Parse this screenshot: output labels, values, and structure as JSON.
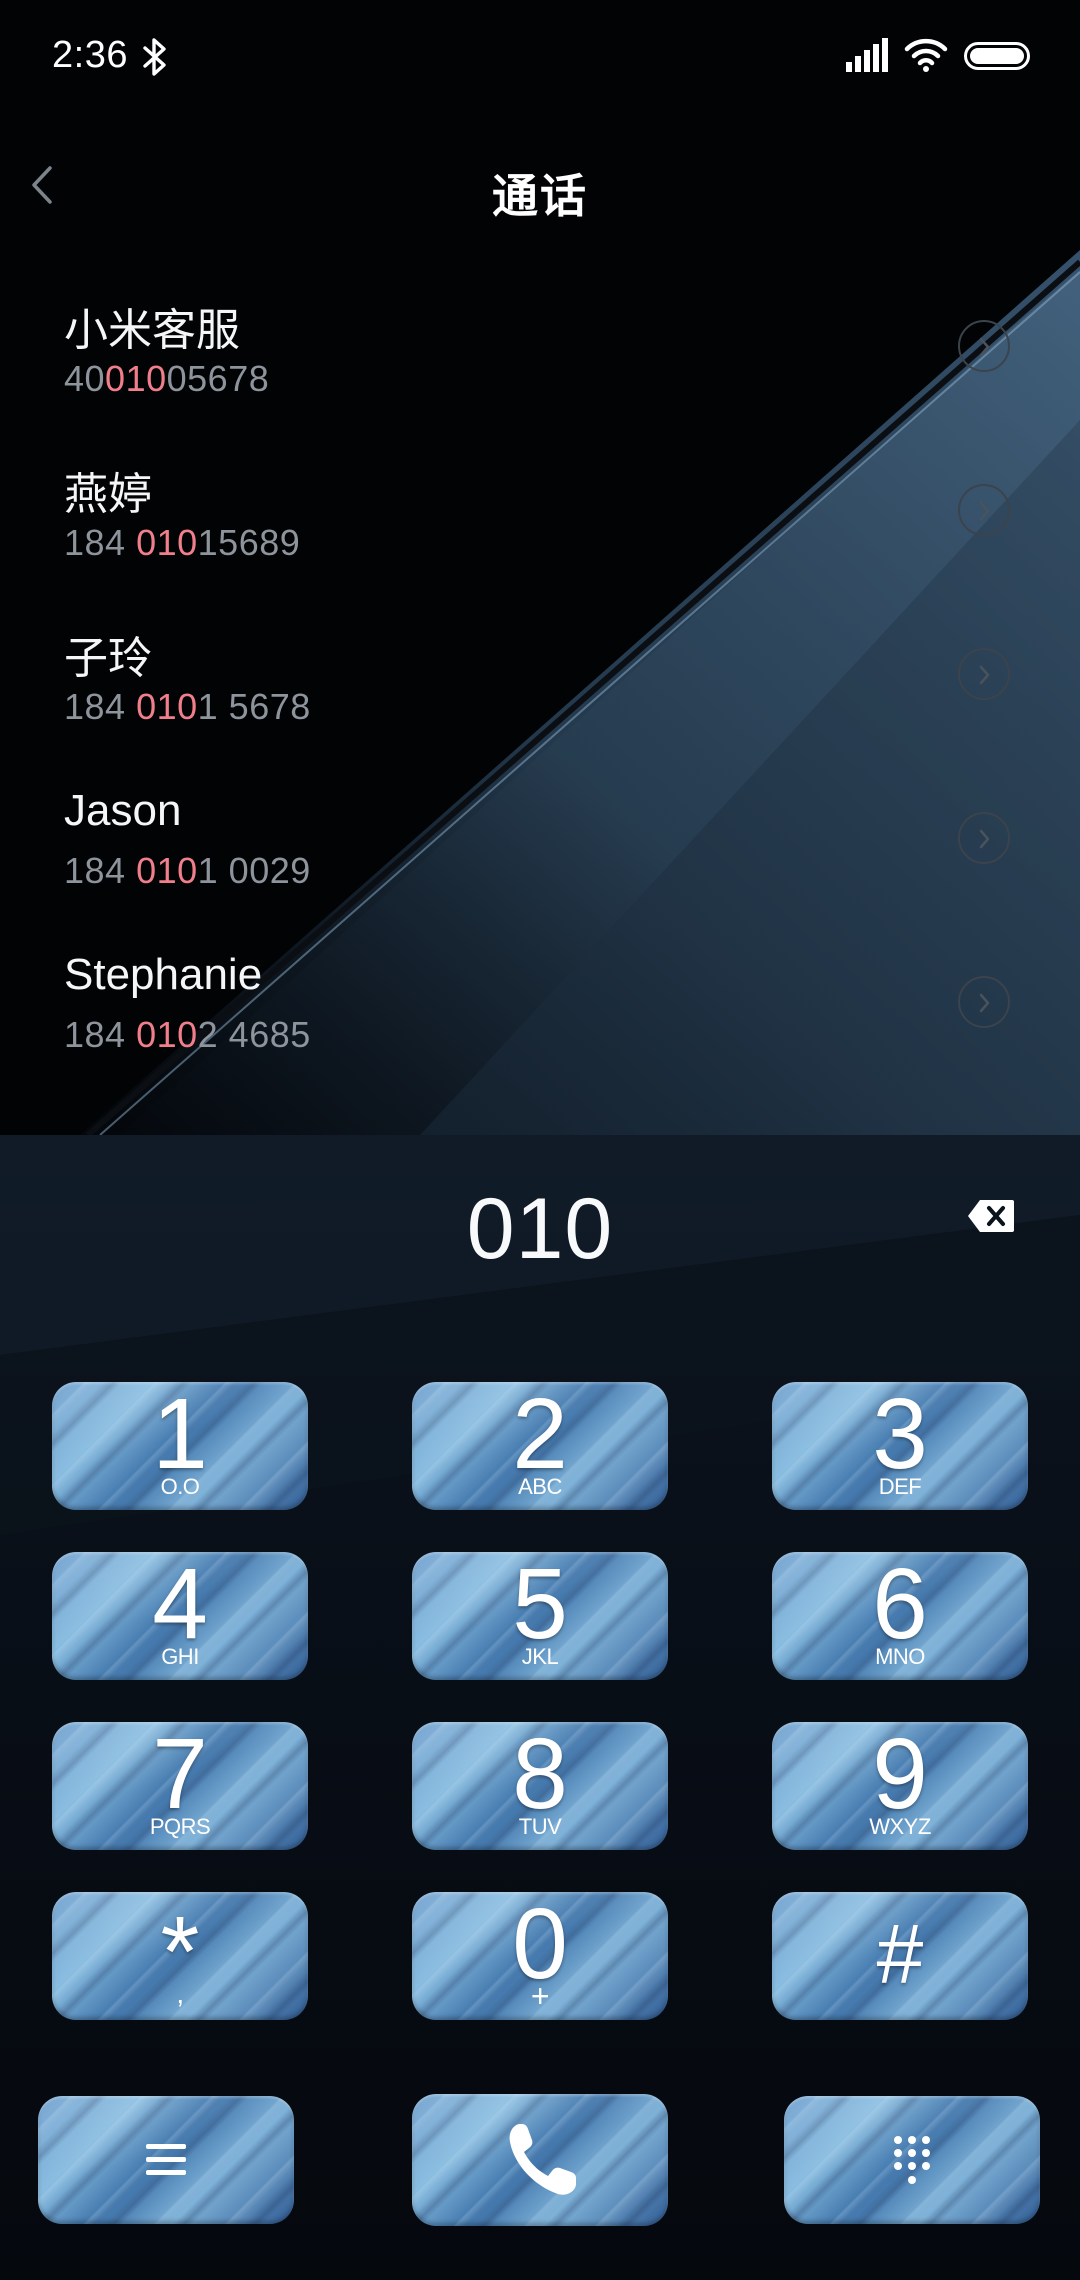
{
  "status_bar": {
    "time": "2:36",
    "icons": [
      "bluetooth-icon",
      "cellular-signal-icon",
      "wifi-icon",
      "battery-icon"
    ]
  },
  "header": {
    "title": "通话",
    "back_icon": "chevron-left-icon"
  },
  "contacts": [
    {
      "name": "小米客服",
      "number_before": "40",
      "number_match": "010",
      "number_after": "05678"
    },
    {
      "name": "燕婷",
      "number_before": "184 ",
      "number_match": "010",
      "number_after": "15689"
    },
    {
      "name": "子玲",
      "number_before": "184 ",
      "number_match": "010",
      "number_after": "1 5678"
    },
    {
      "name": "Jason",
      "number_before": "184 ",
      "number_match": "010",
      "number_after": "1 0029"
    },
    {
      "name": "Stephanie",
      "number_before": "184 ",
      "number_match": "010",
      "number_after": "2 4685"
    }
  ],
  "dialer": {
    "input_value": "010",
    "delete_icon": "backspace-icon"
  },
  "keypad": [
    {
      "digit": "1",
      "letters": "O.O"
    },
    {
      "digit": "2",
      "letters": "ABC"
    },
    {
      "digit": "3",
      "letters": "DEF"
    },
    {
      "digit": "4",
      "letters": "GHI"
    },
    {
      "digit": "5",
      "letters": "JKL"
    },
    {
      "digit": "6",
      "letters": "MNO"
    },
    {
      "digit": "7",
      "letters": "PQRS"
    },
    {
      "digit": "8",
      "letters": "TUV"
    },
    {
      "digit": "9",
      "letters": "WXYZ"
    },
    {
      "digit": "*",
      "letters": ","
    },
    {
      "digit": "0",
      "letters": "+"
    },
    {
      "digit": "#",
      "letters": ""
    }
  ],
  "bottom_actions": [
    "menu-icon",
    "phone-call-icon",
    "dialpad-icon"
  ],
  "colors": {
    "match_highlight": "#f17e8b",
    "number_text": "#8e949c",
    "key_blue": "#5c93c7",
    "background": "#030406"
  }
}
